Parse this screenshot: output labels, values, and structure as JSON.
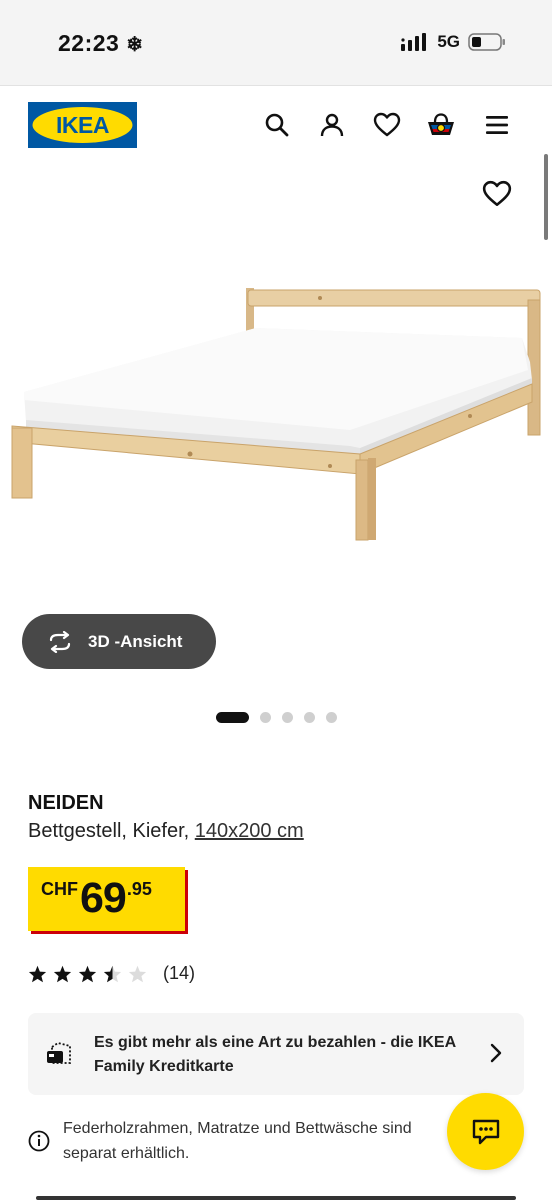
{
  "status_bar": {
    "time": "22:23",
    "network": "5G",
    "icons": [
      "snowflake-icon",
      "signal-icon",
      "battery-icon"
    ]
  },
  "header": {
    "logo_text": "IKEA",
    "icons": [
      "search-icon",
      "account-icon",
      "heart-icon",
      "cart-icon",
      "menu-icon"
    ]
  },
  "gallery": {
    "view_3d_label": "3D -Ansicht",
    "total_images": 5,
    "active_image": 1
  },
  "product": {
    "name": "NEIDEN",
    "description": "Bettgestell, Kiefer,",
    "size": "140x200 cm",
    "price": {
      "currency": "CHF",
      "integer": "69",
      "decimal": ".95"
    },
    "rating": {
      "stars": 3.5,
      "max": 5,
      "count": "(14)"
    }
  },
  "promo": {
    "text": "Es gibt mehr als eine Art zu bezahlen - die IKEA Family Kreditkarte"
  },
  "info": {
    "text": "Federholzrahmen, Matratze und Bettwäsche sind separat erhältlich."
  },
  "colors": {
    "ikea_blue": "#0058a3",
    "ikea_yellow": "#ffdb00",
    "price_red": "#cc0008",
    "button_dark": "#484848"
  }
}
